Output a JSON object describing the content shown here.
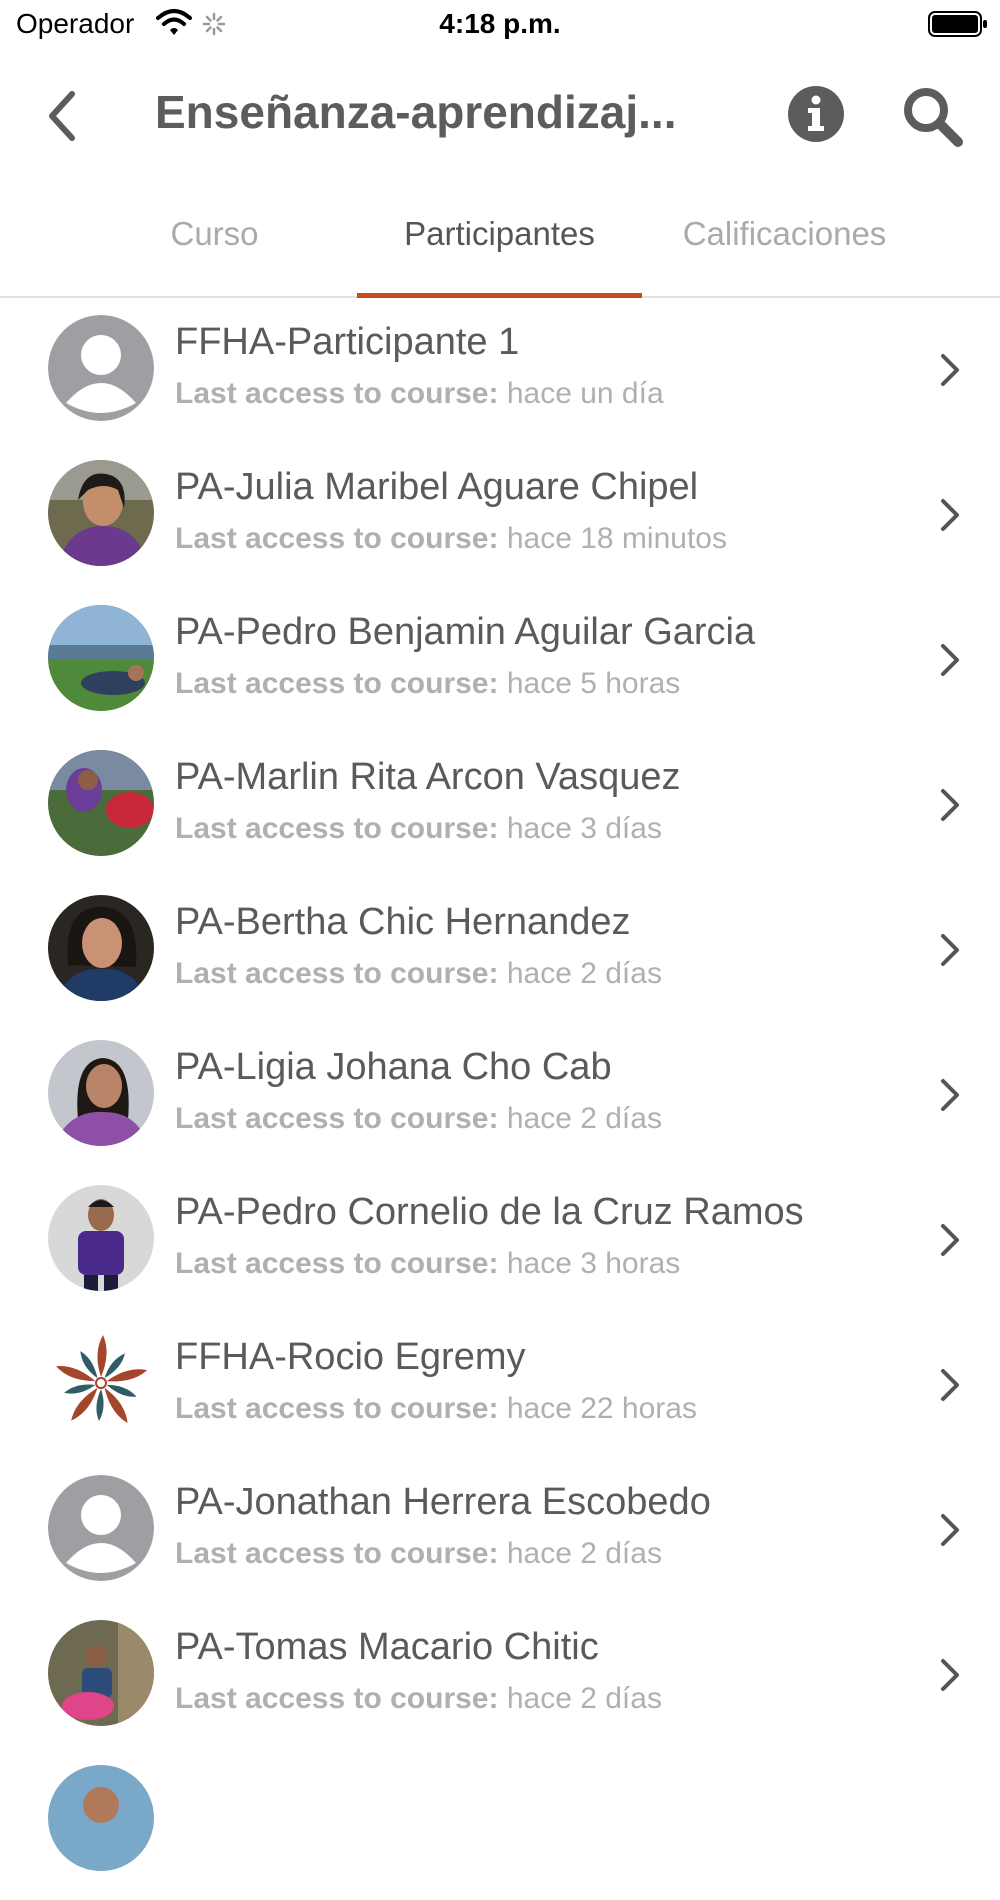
{
  "status_bar": {
    "carrier": "Operador",
    "time": "4:18 p.m."
  },
  "header": {
    "title": "Enseñanza-aprendizaj..."
  },
  "tabs": [
    {
      "label": "Curso"
    },
    {
      "label": "Participantes"
    },
    {
      "label": "Calificaciones"
    }
  ],
  "active_tab": "Participantes",
  "colors": {
    "accent": "#c64b1e",
    "text": "#5a5a5a",
    "muted": "#b0b0b0"
  },
  "participants": [
    {
      "name": "FFHA-Participante 1",
      "access_label": "Last access to course:",
      "access_value": "hace un día",
      "avatar": "default-avatar"
    },
    {
      "name": "PA-Julia Maribel Aguare Chipel",
      "access_label": "Last access to course:",
      "access_value": "hace 18 minutos",
      "avatar": "photo"
    },
    {
      "name": "PA-Pedro Benjamin Aguilar Garcia",
      "access_label": "Last access to course:",
      "access_value": "hace 5 horas",
      "avatar": "photo"
    },
    {
      "name": "PA-Marlin Rita Arcon Vasquez",
      "access_label": "Last access to course:",
      "access_value": "hace 3 días",
      "avatar": "photo"
    },
    {
      "name": "PA-Bertha Chic Hernandez",
      "access_label": "Last access to course:",
      "access_value": "hace 2 días",
      "avatar": "photo"
    },
    {
      "name": "PA-Ligia Johana Cho Cab",
      "access_label": "Last access to course:",
      "access_value": "hace 2 días",
      "avatar": "photo"
    },
    {
      "name": "PA-Pedro Cornelio de la Cruz Ramos",
      "access_label": "Last access to course:",
      "access_value": "hace 3 horas",
      "avatar": "photo"
    },
    {
      "name": "FFHA-Rocio Egremy",
      "access_label": "Last access to course:",
      "access_value": "hace 22 horas",
      "avatar": "logo"
    },
    {
      "name": "PA-Jonathan Herrera Escobedo",
      "access_label": "Last access to course:",
      "access_value": "hace 2 días",
      "avatar": "default-avatar"
    },
    {
      "name": "PA-Tomas Macario Chitic",
      "access_label": "Last access to course:",
      "access_value": "hace 2 días",
      "avatar": "photo"
    }
  ]
}
